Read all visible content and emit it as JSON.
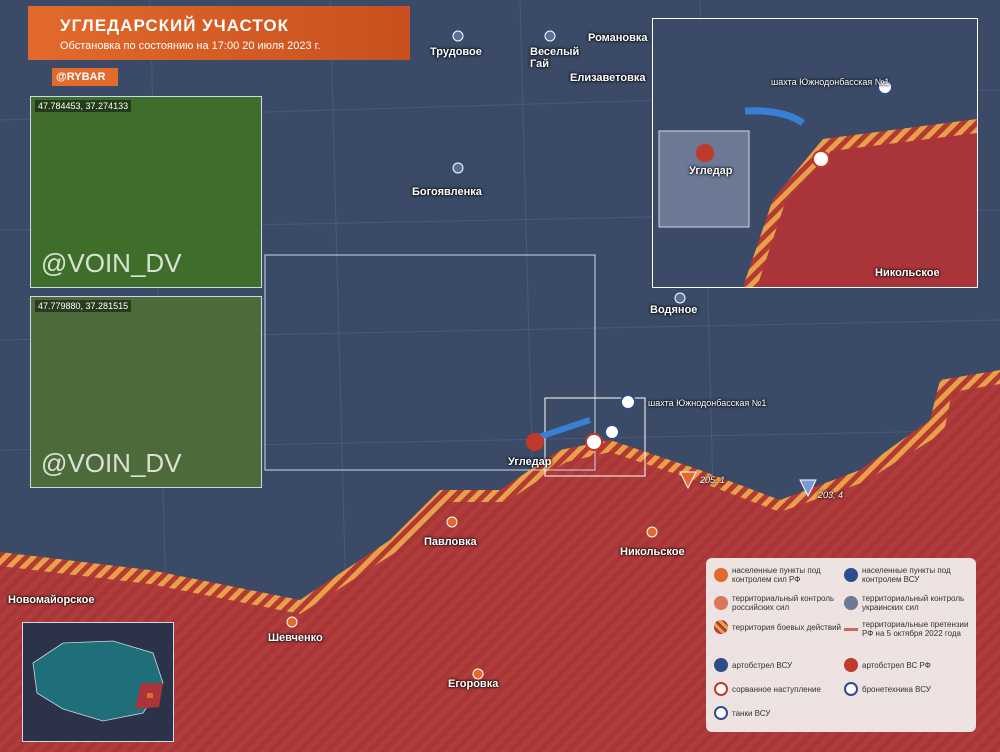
{
  "header": {
    "title": "УГЛЕДАРСКИЙ УЧАСТОК",
    "subtitle": "Обстановка по состоянию на 17:00 20 июля 2023 г.",
    "brand": "@RYBAR"
  },
  "photos": [
    {
      "coords": "47.784453, 37.274133",
      "watermark": "@VOIN_DV"
    },
    {
      "coords": "47.779880, 37.281515",
      "watermark": "@VOIN_DV"
    }
  ],
  "places": {
    "trudovoe": "Трудовое",
    "veselyi": "Веселый\nГай",
    "romanovka": "Романовка",
    "elizavetovka": "Елизаветовка",
    "bogoyavlenka": "Богоявленка",
    "vodyanoe": "Водяное",
    "ugledar": "Угледар",
    "pavlovka": "Павловка",
    "nikolskoe": "Никольское",
    "novomayorskoe": "Новомайорское",
    "shevchenko": "Шевченко",
    "egorovka": "Егоровка",
    "mine": "шахта Южнодонбасская №1",
    "h205": "205, 1",
    "h203": "203, 4"
  },
  "inset": {
    "mine": "шахта Южнодонбасская №1",
    "ugledar": "Угледар",
    "nikolskoe": "Никольское"
  },
  "legend": {
    "ru_settle": "населенные пункты под контролем сил РФ",
    "ua_settle": "населенные пункты под контролем ВСУ",
    "ru_terr": "территориальный контроль российских сил",
    "ua_terr": "территориальный контроль украинских сил",
    "combat": "территория боевых действий",
    "claims": "территориальные претензии РФ на 5 октября 2022 года",
    "art_ua": "артобстрел ВСУ",
    "art_ru": "артобстрел ВС РФ",
    "failed": "сорванное наступление",
    "armor": "бронетехника ВСУ",
    "tanks": "танки ВСУ"
  },
  "colors": {
    "ru": "#a9353a",
    "ua": "#2f4c8a",
    "accent": "#e26a2c",
    "map": "#3b4a66"
  }
}
